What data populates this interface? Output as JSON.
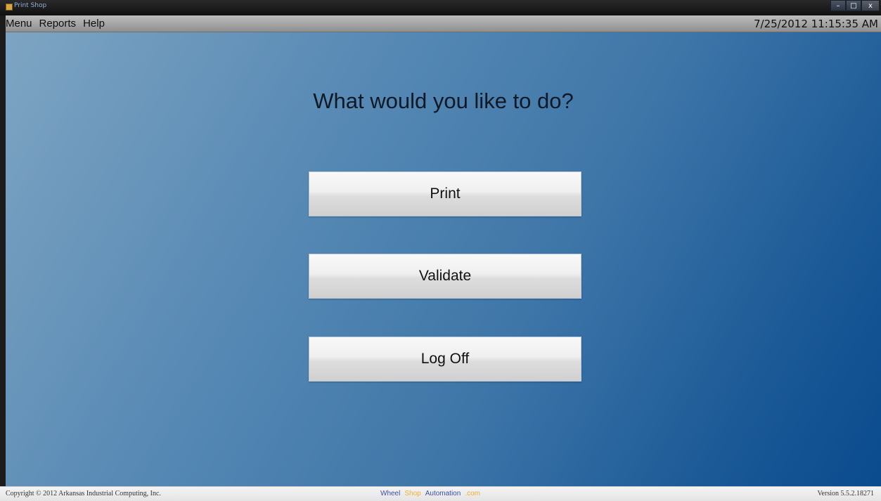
{
  "window": {
    "title": "Print Shop",
    "controls": {
      "minimize": "–",
      "maximize": "□",
      "close": "x"
    }
  },
  "menubar": {
    "items": [
      {
        "label": "Menu"
      },
      {
        "label": "Reports"
      },
      {
        "label": "Help"
      }
    ],
    "datetime": "7/25/2012 11:15:35 AM"
  },
  "main": {
    "prompt": "What would you like to do?",
    "buttons": [
      {
        "label": "Print"
      },
      {
        "label": "Validate"
      },
      {
        "label": "Log Off"
      }
    ]
  },
  "statusbar": {
    "copyright": "Copyright © 2012 Arkansas Industrial Computing, Inc.",
    "brand": {
      "wheel": "Wheel",
      "shop": "Shop",
      "automation": "Automation",
      "com": ".com"
    },
    "version": "Version 5.5.2.18271"
  },
  "colors": {
    "brand_blue": "#3a4fb0",
    "brand_orange": "#f0b030",
    "main_gradient_start": "#7ea4c2",
    "main_gradient_end": "#0a4b8e"
  }
}
